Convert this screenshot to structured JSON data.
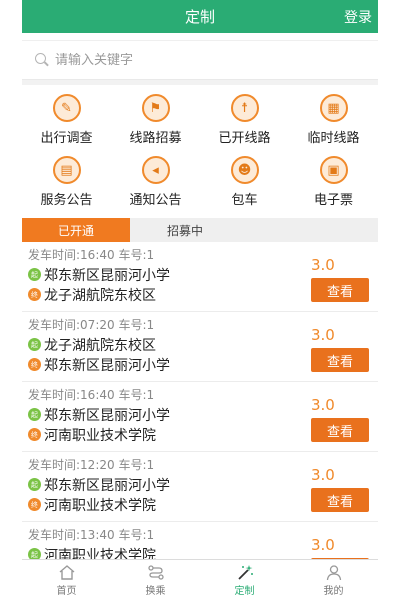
{
  "header": {
    "title": "定制",
    "login_label": "登录"
  },
  "search": {
    "placeholder": "请输入关键字"
  },
  "services": [
    {
      "label": "出行调查",
      "icon": "survey-icon",
      "glyph": "✎"
    },
    {
      "label": "线路招募",
      "icon": "flag-icon",
      "glyph": "⚑"
    },
    {
      "label": "已开线路",
      "icon": "signpost-icon",
      "glyph": "☨"
    },
    {
      "label": "临时线路",
      "icon": "calendar-icon",
      "glyph": "▦"
    },
    {
      "label": "服务公告",
      "icon": "notice-board-icon",
      "glyph": "▤"
    },
    {
      "label": "通知公告",
      "icon": "megaphone-icon",
      "glyph": "◂"
    },
    {
      "label": "包车",
      "icon": "group-icon",
      "glyph": "☻"
    },
    {
      "label": "电子票",
      "icon": "ticket-icon",
      "glyph": "▣"
    }
  ],
  "tabs": [
    {
      "label": "已开通",
      "active": true
    },
    {
      "label": "招募中",
      "active": false
    }
  ],
  "start_badge": "起",
  "end_badge": "终",
  "view_label": "查看",
  "routes": [
    {
      "time": "发车时间:16:40 车号:1",
      "from": "郑东新区昆丽河小学",
      "to": "龙子湖航院东校区",
      "price": "3.0"
    },
    {
      "time": "发车时间:07:20 车号:1",
      "from": "龙子湖航院东校区",
      "to": "郑东新区昆丽河小学",
      "price": "3.0"
    },
    {
      "time": "发车时间:16:40 车号:1",
      "from": "郑东新区昆丽河小学",
      "to": "河南职业技术学院",
      "price": "3.0"
    },
    {
      "time": "发车时间:12:20 车号:1",
      "from": "郑东新区昆丽河小学",
      "to": "河南职业技术学院",
      "price": "3.0"
    },
    {
      "time": "发车时间:13:40 车号:1",
      "from": "河南职业技术学院",
      "to": "",
      "price": "3.0"
    }
  ],
  "bottom_nav": [
    {
      "label": "首页",
      "icon": "home-icon",
      "active": false
    },
    {
      "label": "换乘",
      "icon": "transfer-icon",
      "active": false
    },
    {
      "label": "定制",
      "icon": "magic-wand-icon",
      "active": true
    },
    {
      "label": "我的",
      "icon": "user-icon",
      "active": false
    }
  ],
  "colors": {
    "brand_green": "#2aac74",
    "accent_orange": "#f07a20"
  }
}
